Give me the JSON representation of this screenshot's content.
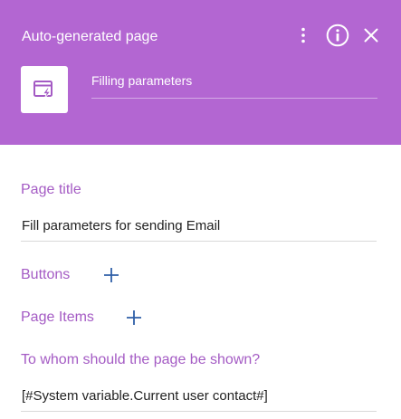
{
  "header": {
    "title": "Auto-generated page",
    "name_value": "Filling parameters",
    "icons": {
      "more": "more-vertical-icon",
      "info": "info-icon",
      "close": "close-icon",
      "page": "page-lightning-icon"
    },
    "background_color": "#b366d2"
  },
  "fields": {
    "page_title": {
      "label": "Page title",
      "value": "Fill parameters for sending Email"
    },
    "buttons": {
      "label": "Buttons"
    },
    "page_items": {
      "label": "Page Items"
    },
    "recipient": {
      "label": "To whom should the page be shown?",
      "value": "[#System variable.Current user contact#]"
    }
  },
  "colors": {
    "label": "#a45bc4",
    "add_icon": "#2f5fa8",
    "text": "#222222"
  }
}
